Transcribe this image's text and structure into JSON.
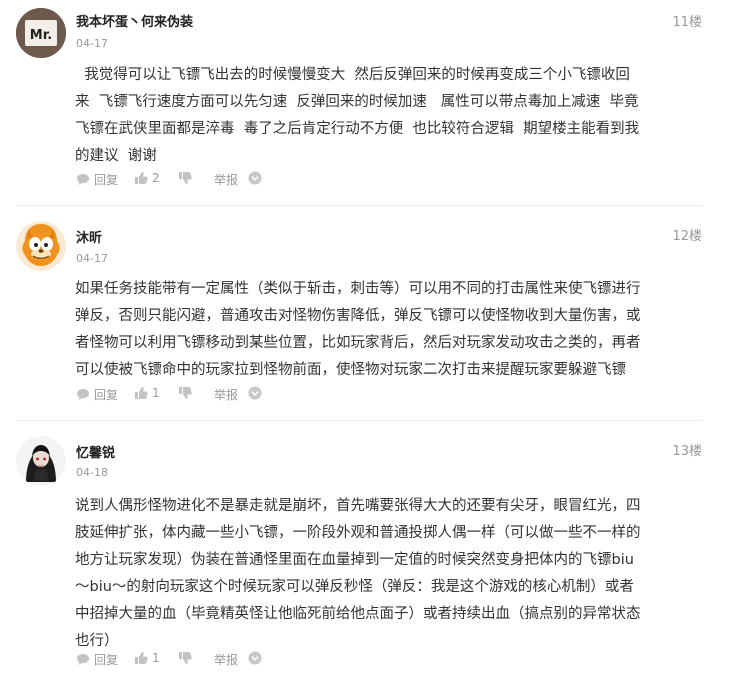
{
  "comments": [
    {
      "username": "我本坏蛋丶何来伪装",
      "avatar_text": "Mr.",
      "date": "04-17",
      "floor": "11楼",
      "lines": [
        "  我觉得可以让飞镖飞出去的时候慢慢变大  然后反弹回来的时候再变成三个小飞镖收回",
        "来  飞镖飞行速度方面可以先匀速  反弹回来的时候加速   属性可以带点毒加上减速  毕竟",
        "飞镖在武侠里面都是淬毒  毒了之后肯定行动不方便  也比较符合逻辑  期望楼主能看到我",
        "的建议  谢谢"
      ],
      "reply_label": "回复",
      "like_count": "2",
      "report_label": "举报"
    },
    {
      "username": "沐昕",
      "date": "04-17",
      "floor": "12楼",
      "lines": [
        "如果任务技能带有一定属性（类似于斩击，刺击等）可以用不同的打击属性来使飞镖进行",
        "弹反，否则只能闪避，普通攻击对怪物伤害降低，弹反飞镖可以使怪物收到大量伤害，或",
        "者怪物可以利用飞镖移动到某些位置，比如玩家背后，然后对玩家发动攻击之类的，再者",
        "可以使被飞镖命中的玩家拉到怪物前面，使怪物对玩家二次打击来提醒玩家要躲避飞镖"
      ],
      "reply_label": "回复",
      "like_count": "1",
      "report_label": "举报"
    },
    {
      "username": "忆馨锐",
      "date": "04-18",
      "floor": "13楼",
      "lines": [
        "说到人偶形怪物进化不是暴走就是崩坏，首先嘴要张得大大的还要有尖牙，眼冒红光，四",
        "肢延伸扩张，体内藏一些小飞镖，一阶段外观和普通投掷人偶一样（可以做一些不一样的",
        "地方让玩家发现）伪装在普通怪里面在血量掉到一定值的时候突然变身把体内的飞镖biu",
        "～biu～的射向玩家这个时候玩家可以弹反秒怪（弹反：我是这个游戏的核心机制）或者",
        "中招掉大量的血（毕竟精英怪让他临死前给他点面子）或者持续出血（搞点别的异常状态",
        "也行）"
      ],
      "reply_label": "回复",
      "like_count": "1",
      "report_label": "举报"
    }
  ]
}
